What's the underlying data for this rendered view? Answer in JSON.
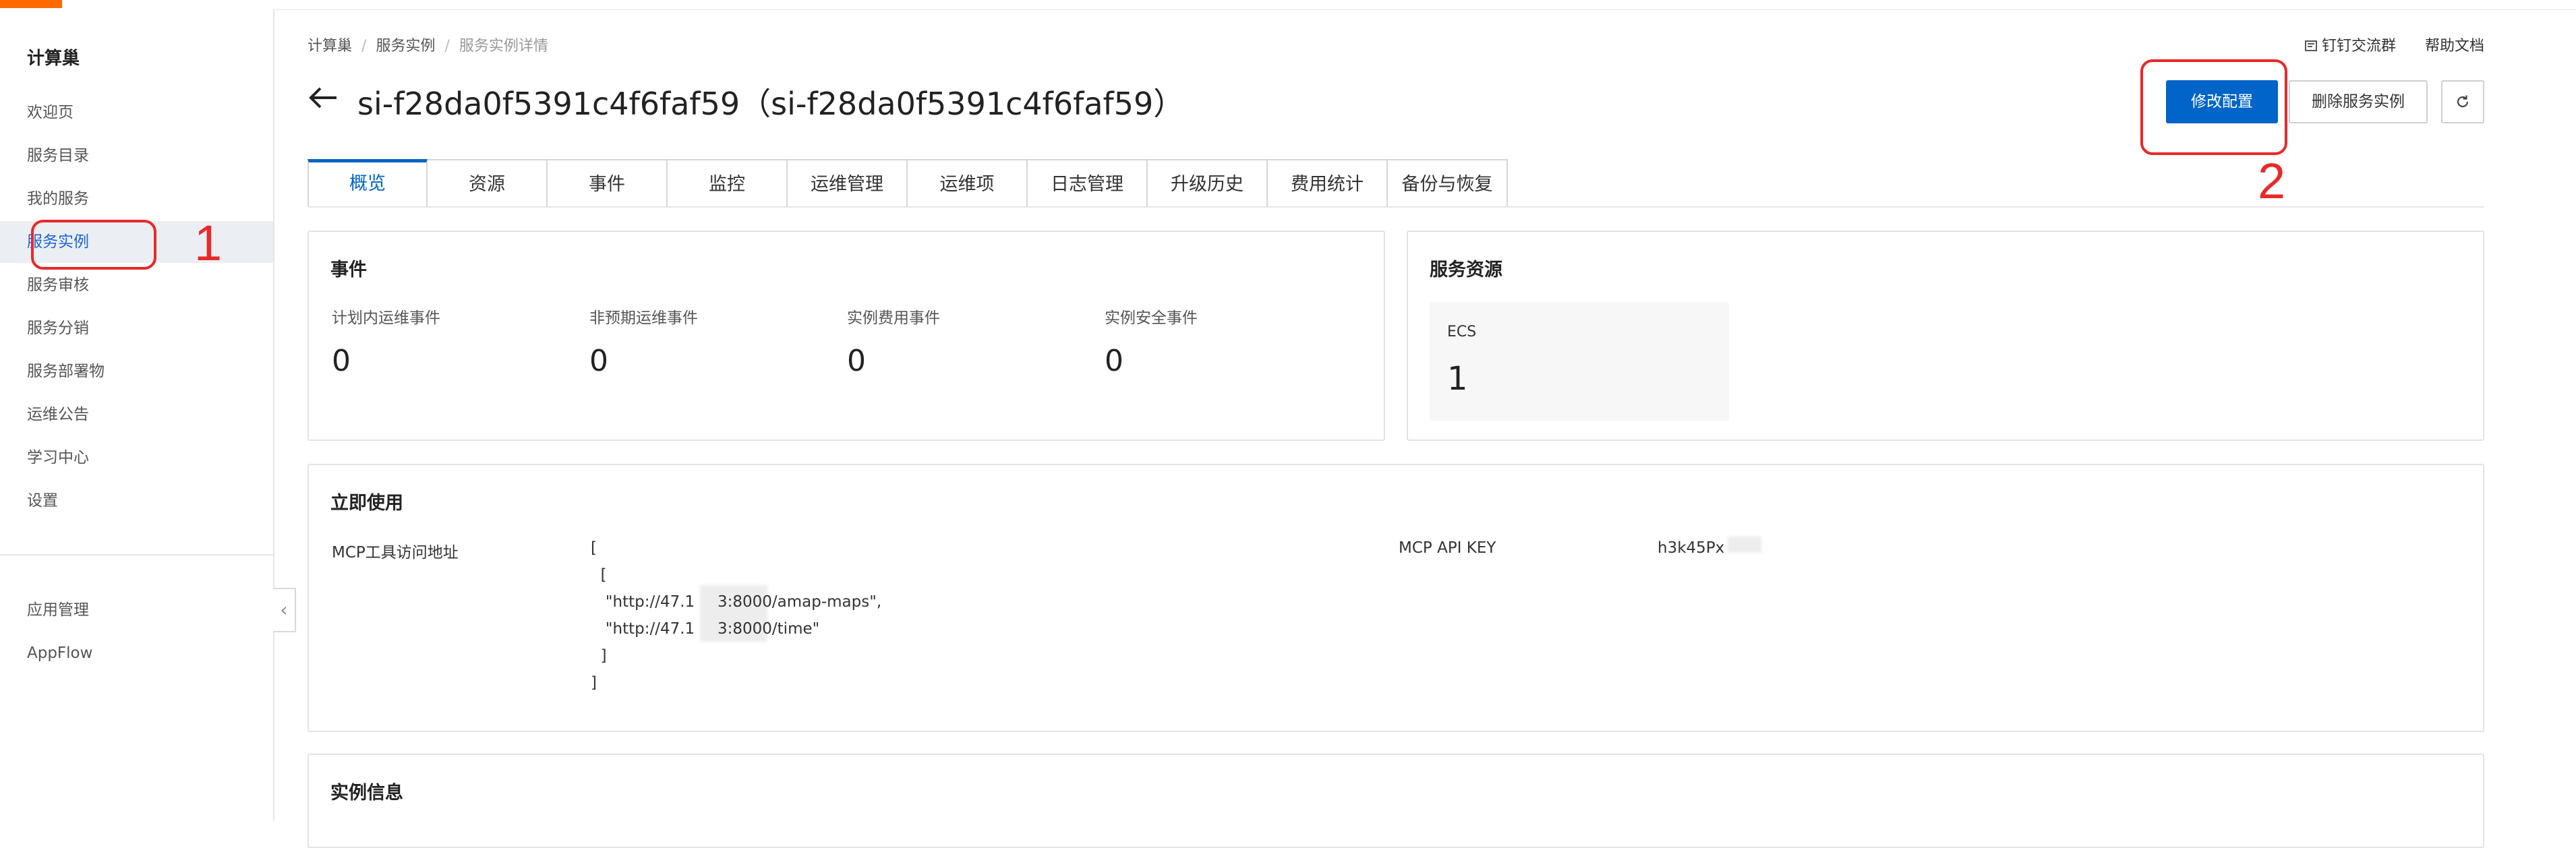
{
  "app": {
    "name": "计算巢"
  },
  "sidebar": {
    "title": "计算巢",
    "items": [
      {
        "label": "欢迎页"
      },
      {
        "label": "服务目录"
      },
      {
        "label": "我的服务"
      },
      {
        "label": "服务实例",
        "active": true
      },
      {
        "label": "服务审核"
      },
      {
        "label": "服务分销"
      },
      {
        "label": "服务部署物"
      },
      {
        "label": "运维公告"
      },
      {
        "label": "学习中心"
      },
      {
        "label": "设置"
      }
    ],
    "extra_items": [
      {
        "label": "应用管理"
      },
      {
        "label": "AppFlow"
      }
    ]
  },
  "breadcrumb": [
    "计算巢",
    "服务实例",
    "服务实例详情"
  ],
  "top_links": {
    "dingtalk": "钉钉交流群",
    "help": "帮助文档"
  },
  "header": {
    "title": "si-f28da0f5391c4f6faf59（si-f28da0f5391c4f6faf59）"
  },
  "actions": {
    "modify": "修改配置",
    "delete": "删除服务实例",
    "refresh_icon": "refresh-icon"
  },
  "annotations": {
    "one": "1",
    "two": "2"
  },
  "tabs": [
    {
      "label": "概览",
      "active": true
    },
    {
      "label": "资源"
    },
    {
      "label": "事件"
    },
    {
      "label": "监控"
    },
    {
      "label": "运维管理"
    },
    {
      "label": "运维项"
    },
    {
      "label": "日志管理"
    },
    {
      "label": "升级历史"
    },
    {
      "label": "费用统计"
    },
    {
      "label": "备份与恢复"
    }
  ],
  "events": {
    "title": "事件",
    "stats": [
      {
        "label": "计划内运维事件",
        "value": "0"
      },
      {
        "label": "非预期运维事件",
        "value": "0"
      },
      {
        "label": "实例费用事件",
        "value": "0"
      },
      {
        "label": "实例安全事件",
        "value": "0"
      }
    ]
  },
  "resources": {
    "title": "服务资源",
    "items": [
      {
        "label": "ECS",
        "value": "1"
      }
    ]
  },
  "use_now": {
    "title": "立即使用",
    "mcp_label": "MCP工具访问地址",
    "mcp_lines": [
      "[",
      "  [",
      "   \"http://47.1",
      "   \"http://47.1",
      "  ]",
      "]"
    ],
    "mcp_suffix_1": "3:8000/amap-maps\",",
    "mcp_suffix_2": "3:8000/time\"",
    "api_key_label": "MCP API KEY",
    "api_key_value": "h3k45Px"
  },
  "instance_info": {
    "title": "实例信息"
  },
  "colors": {
    "primary": "#0064c8",
    "annotation": "#e8292a",
    "brand": "#ff6a00"
  }
}
